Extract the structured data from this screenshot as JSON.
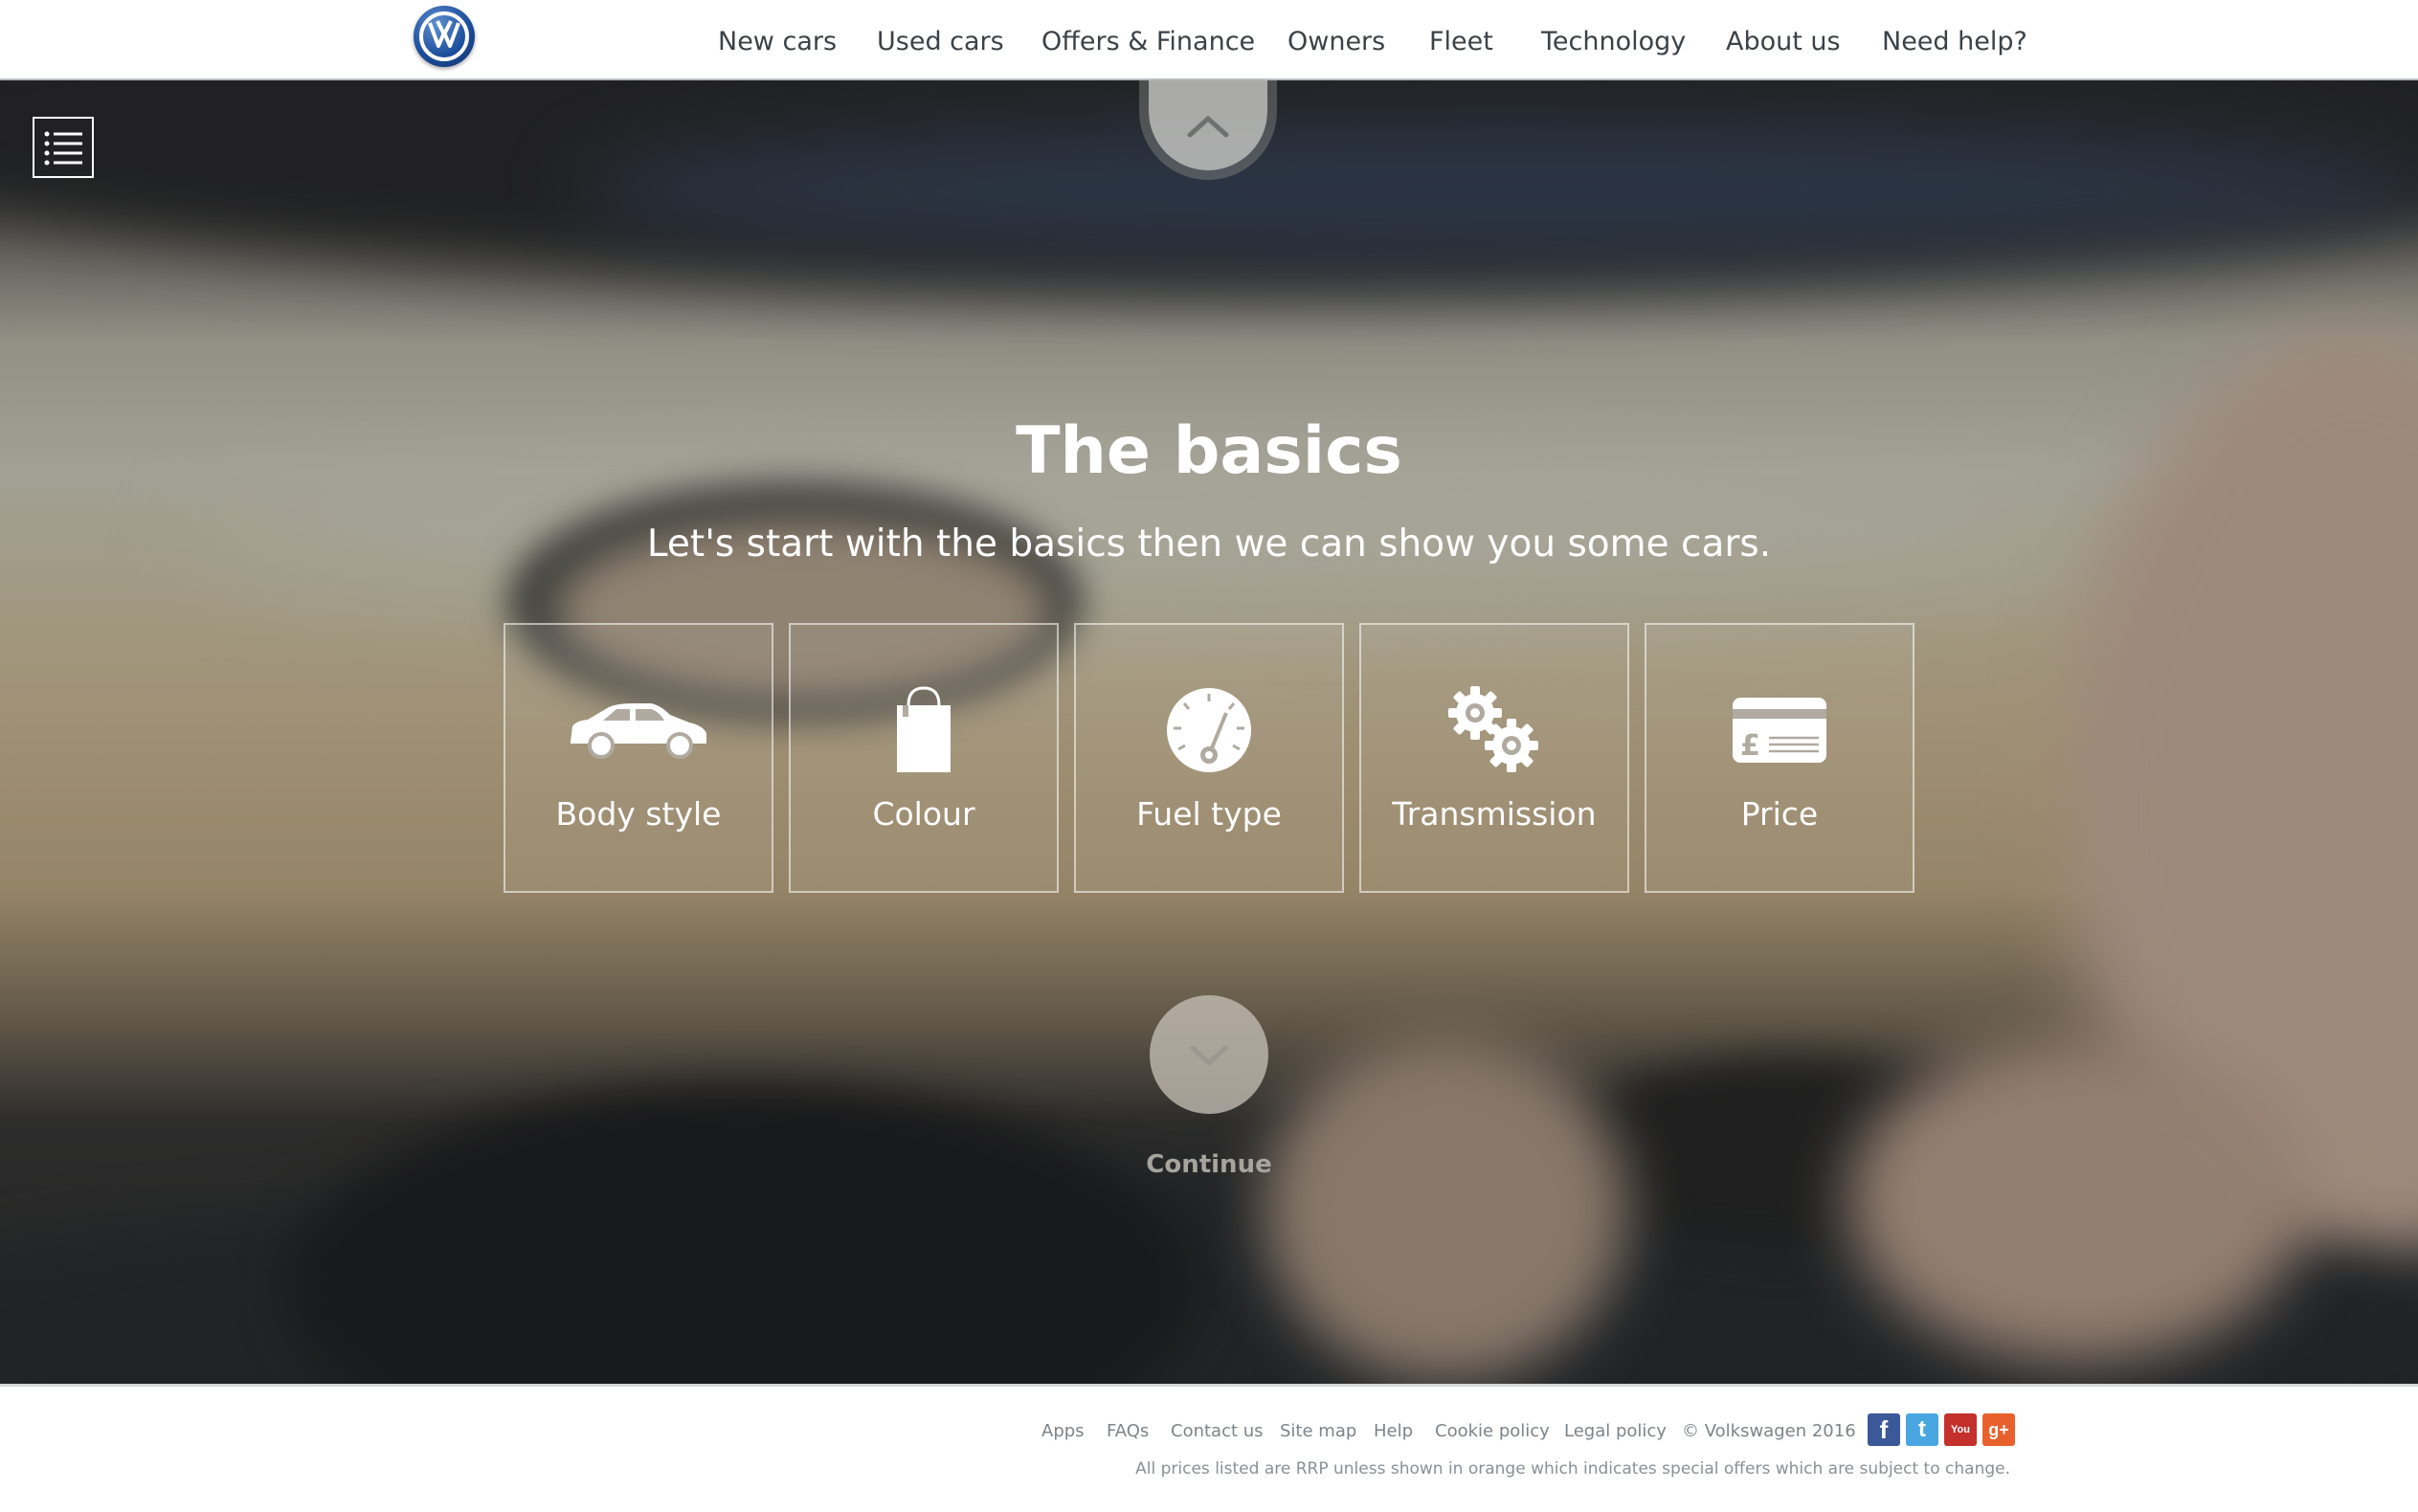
{
  "header": {
    "nav": [
      {
        "label": "New cars"
      },
      {
        "label": "Used cars"
      },
      {
        "label": "Offers & Finance"
      },
      {
        "label": "Owners"
      },
      {
        "label": "Fleet"
      },
      {
        "label": "Technology"
      },
      {
        "label": "About us"
      },
      {
        "label": "Need help?"
      }
    ]
  },
  "hero": {
    "title": "The basics",
    "subtitle": "Let's start with the basics then we can show you some cars.",
    "cards": [
      {
        "label": "Body style",
        "icon": "car-icon"
      },
      {
        "label": "Colour",
        "icon": "paint-can-icon"
      },
      {
        "label": "Fuel type",
        "icon": "gauge-icon"
      },
      {
        "label": "Transmission",
        "icon": "gears-icon"
      },
      {
        "label": "Price",
        "icon": "credit-card-pound-icon"
      }
    ],
    "continue_label": "Continue"
  },
  "footer": {
    "links": [
      {
        "label": "Apps"
      },
      {
        "label": "FAQs"
      },
      {
        "label": "Contact us"
      },
      {
        "label": "Site map"
      },
      {
        "label": "Help"
      },
      {
        "label": "Cookie policy"
      },
      {
        "label": "Legal policy"
      }
    ],
    "copyright": "© Volkswagen 2016",
    "social": [
      {
        "name": "facebook-icon",
        "glyph": "f",
        "color": "#3b5998"
      },
      {
        "name": "twitter-icon",
        "glyph": "t",
        "color": "#4aa6e0"
      },
      {
        "name": "youtube-icon",
        "glyph": "You",
        "color": "#c4302b"
      },
      {
        "name": "google-plus-icon",
        "glyph": "g+",
        "color": "#e8612c"
      }
    ],
    "disclaimer": "All prices listed are RRP unless shown in orange which indicates special offers which are subject to change."
  }
}
